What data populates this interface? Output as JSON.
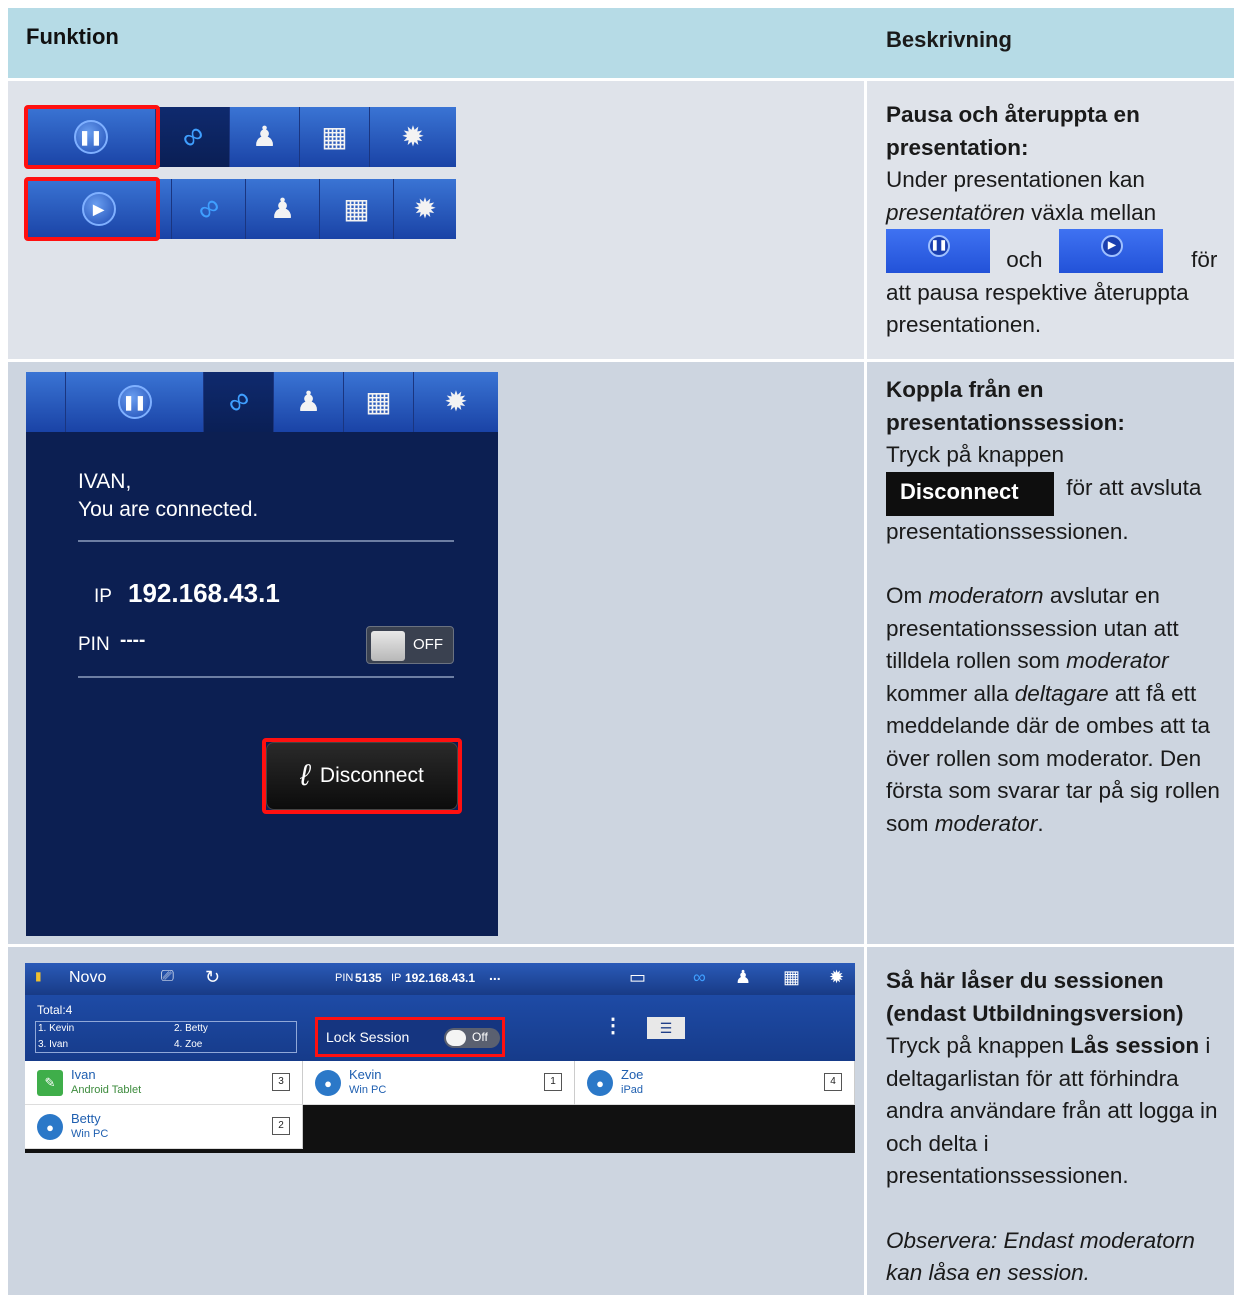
{
  "header": {
    "col1": "Funktion",
    "col2": "Beskrivning"
  },
  "row1": {
    "title": "Pausa och återuppta en presentation:",
    "text_a": "Under presentationen kan",
    "text_a_em": "presentatören",
    "text_b": "växla mellan",
    "och": "och",
    "for": "för",
    "text_c": "att pausa respektive återuppta presentationen.",
    "icons": [
      "pause-icon",
      "link-icon",
      "participants-icon",
      "grid-icon",
      "gear-icon",
      "play-icon"
    ]
  },
  "row2": {
    "title": "Koppla från en presentationssession:",
    "text_a": "Tryck på knappen",
    "disconnect_label": "Disconnect",
    "text_b": "för att avsluta presentationssessionen.",
    "p2_1": "Om",
    "p2_em1": "moderatorn",
    "p2_2": "avslutar en presentationssession utan att tilldela rollen som",
    "p2_em2": "moderator",
    "p2_3": "kommer alla",
    "p2_em3": "deltagare",
    "p2_4": "att få ett meddelande där de ombes att ta över rollen som moderator. Den första som svarar tar på sig rollen som",
    "p2_em4": "moderator",
    "p2_5": ".",
    "screen": {
      "greeting": "IVAN,",
      "status": "You are connected.",
      "ip_label": "IP",
      "ip_value": "192.168.43.1",
      "pin_label": "PIN",
      "pin_value": "----",
      "toggle": "OFF",
      "button": "Disconnect"
    }
  },
  "row3": {
    "title": "Så här låser du sessionen (endast Utbildningsversion)",
    "text_a": "Tryck på knappen",
    "text_bold": "Lås session",
    "text_b": "i deltagarlistan för att förhindra andra användare från att logga in och delta i presentationssessionen.",
    "note": "Observera: Endast moderatorn kan låsa en session.",
    "screen": {
      "app_name": "Novo",
      "pin_label": "PIN",
      "pin_value": "5135",
      "ip_label": "IP",
      "ip_value": "192.168.43.1",
      "more": "...",
      "total": "Total:4",
      "list": [
        "1. Kevin",
        "2. Betty",
        "3. Ivan",
        "4. Zoe"
      ],
      "lock_label": "Lock Session",
      "lock_state": "Off",
      "people": [
        {
          "name": "Ivan",
          "device": "Android Tablet",
          "num": "3"
        },
        {
          "name": "Kevin",
          "device": "Win PC",
          "num": "1"
        },
        {
          "name": "Zoe",
          "device": "iPad",
          "num": "4"
        },
        {
          "name": "Betty",
          "device": "Win PC",
          "num": "2"
        }
      ]
    }
  }
}
